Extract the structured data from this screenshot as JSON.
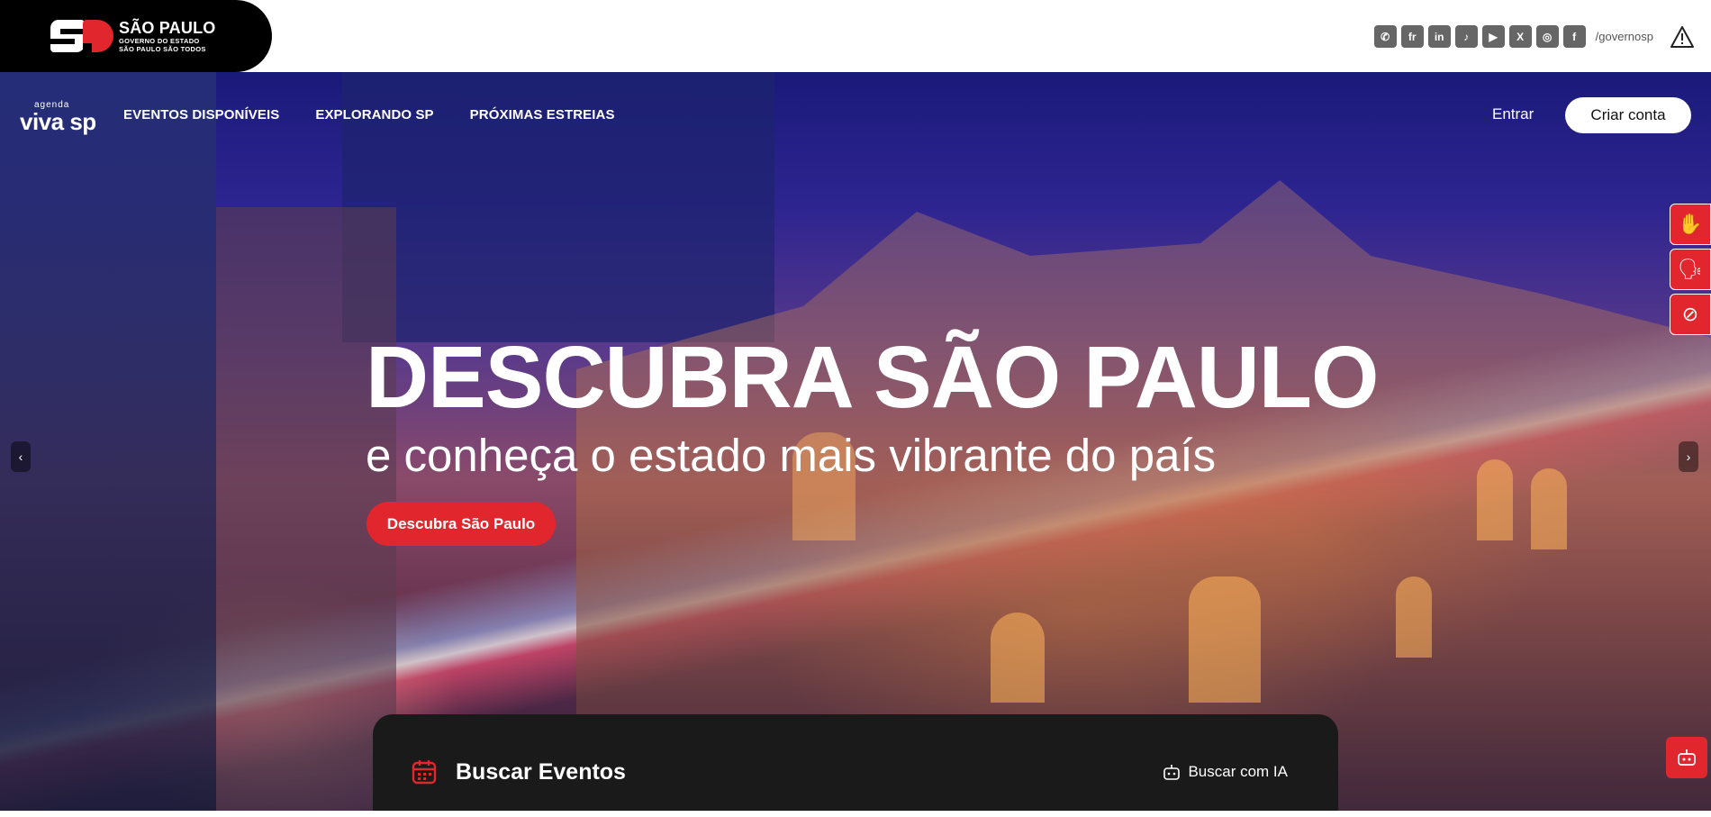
{
  "gov_header": {
    "brand_line1": "SÃO PAULO",
    "brand_line2": "GOVERNO DO ESTADO",
    "brand_line3": "SÃO PAULO SÃO TODOS",
    "social_icons": [
      "whatsapp-icon",
      "flickr-icon",
      "linkedin-icon",
      "tiktok-icon",
      "youtube-icon",
      "x-icon",
      "instagram-icon",
      "facebook-icon"
    ],
    "social_glyphs": [
      "✆",
      "fr",
      "in",
      "♪",
      "▶",
      "X",
      "◎",
      "f"
    ],
    "handle": "/governosp",
    "alert_icon": "warning-icon"
  },
  "nav": {
    "logo_small": "agenda",
    "logo_main": "viva sp",
    "items": [
      {
        "label": "EVENTOS DISPONÍVEIS"
      },
      {
        "label": "EXPLORANDO SP"
      },
      {
        "label": "PRÓXIMAS ESTREIAS"
      }
    ],
    "login_label": "Entrar",
    "signup_label": "Criar conta"
  },
  "accessibility": {
    "buttons": [
      "sign-language-icon",
      "audio-description-icon",
      "low-vision-icon"
    ]
  },
  "hero": {
    "headline": "DESCUBRA SÃO PAULO",
    "subheadline": "e conheça o estado mais vibrante do país",
    "cta_label": "Descubra São Paulo",
    "prev_arrow": "‹",
    "next_arrow": "›"
  },
  "search": {
    "title": "Buscar Eventos",
    "ai_label": "Buscar com IA"
  },
  "colors": {
    "brand_red": "#e1262d",
    "panel_dark": "#1a1a1a"
  }
}
